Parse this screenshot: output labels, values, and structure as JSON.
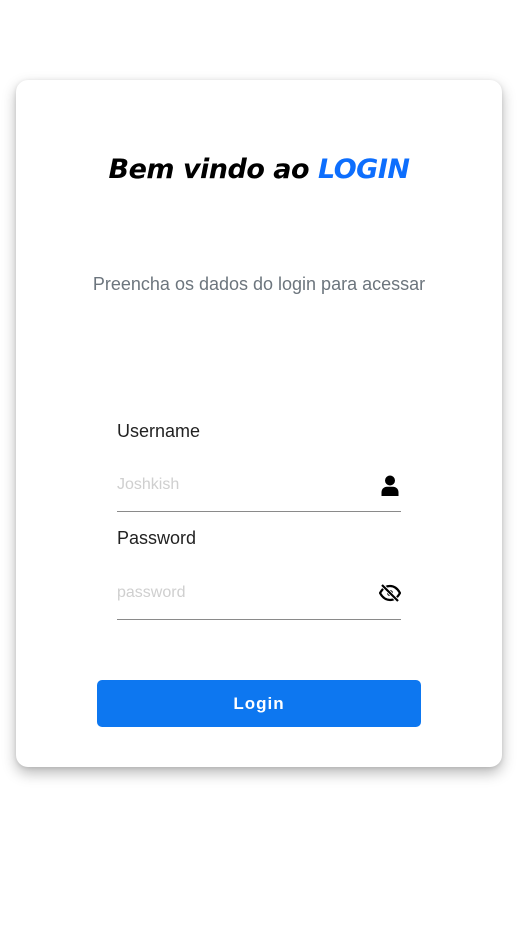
{
  "header": {
    "title_prefix": "Bem vindo ao ",
    "title_accent": "LOGIN",
    "subtitle": "Preencha os dados do login para acessar"
  },
  "form": {
    "username_label": "Username",
    "username_placeholder": "Joshkish",
    "username_value": "",
    "username_icon": "user-icon",
    "password_label": "Password",
    "password_placeholder": "password",
    "password_value": "",
    "password_icon": "eye-slash-icon",
    "submit_label": "Login"
  },
  "colors": {
    "accent": "#0d6efd",
    "button": "#0d77f0",
    "subtitle": "#6c757d"
  }
}
